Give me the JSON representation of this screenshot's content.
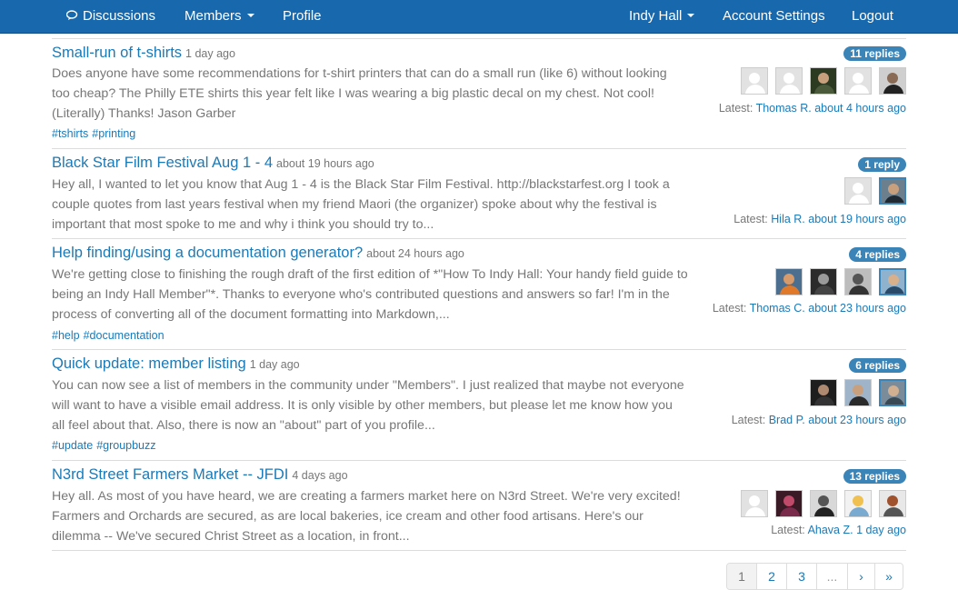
{
  "nav": {
    "discussions": "Discussions",
    "members": "Members",
    "profile": "Profile",
    "space": "Indy Hall",
    "account_settings": "Account Settings",
    "logout": "Logout"
  },
  "threads": [
    {
      "title": "Small-run of t-shirts",
      "time": "1 day ago",
      "body": "Does anyone have some recommendations for t-shirt printers that can do a small run (like 6) without looking too cheap? The Philly ETE shirts this year felt like I was wearing a big plastic decal on my chest. Not cool! (Literally) Thanks! Jason Garber",
      "tags": [
        "#tshirts",
        "#printing"
      ],
      "replies": "11 replies",
      "latest_label": "Latest:",
      "latest_user": "Thomas R.",
      "latest_time": "about 4 hours ago"
    },
    {
      "title": "Black Star Film Festival Aug 1 - 4",
      "time": "about 19 hours ago",
      "body": "Hey all, I wanted to let you know that Aug 1 - 4 is the Black Star Film Festival. http://blackstarfest.org I took a couple quotes from last years festival when my friend Maori (the organizer) spoke about why the festival is important that most spoke to me and why i think you should try to...",
      "tags": [],
      "replies": "1 reply",
      "latest_label": "Latest:",
      "latest_user": "Hila R.",
      "latest_time": "about 19 hours ago"
    },
    {
      "title": "Help finding/using a documentation generator?",
      "time": "about 24 hours ago",
      "body": "We're getting close to finishing the rough draft of the first edition of *\"How To Indy Hall: Your handy field guide to being an Indy Hall Member\"*. Thanks to everyone who's contributed questions and answers so far! I'm in the process of converting all of the document formatting into Markdown,...",
      "tags": [
        "#help",
        "#documentation"
      ],
      "replies": "4 replies",
      "latest_label": "Latest:",
      "latest_user": "Thomas C.",
      "latest_time": "about 23 hours ago"
    },
    {
      "title": "Quick update: member listing",
      "time": "1 day ago",
      "body": "You can now see a list of members in the community under \"Members\". I just realized that maybe not everyone will want to have a visible email address. It is only visible by other members, but please let me know how you all feel about that. Also, there is now an \"about\" part of you profile...",
      "tags": [
        "#update",
        "#groupbuzz"
      ],
      "replies": "6 replies",
      "latest_label": "Latest:",
      "latest_user": "Brad P.",
      "latest_time": "about 23 hours ago"
    },
    {
      "title": "N3rd Street Farmers Market -- JFDI",
      "time": "4 days ago",
      "body": "Hey all. As most of you have heard, we are creating a farmers market here on N3rd Street. We're very excited! Farmers and Orchards are secured, as are local bakeries, ice cream and other food artisans. Here's our dilemma -- We've secured Christ Street as a location, in front...",
      "tags": [],
      "replies": "13 replies",
      "latest_label": "Latest:",
      "latest_user": "Ahava Z.",
      "latest_time": "1 day ago"
    }
  ],
  "pagination": [
    "1",
    "2",
    "3",
    "...",
    "›",
    "»"
  ],
  "colors": {
    "navbar": "#1868ad",
    "link": "#1a7ab8",
    "badge": "#3a84b8"
  }
}
